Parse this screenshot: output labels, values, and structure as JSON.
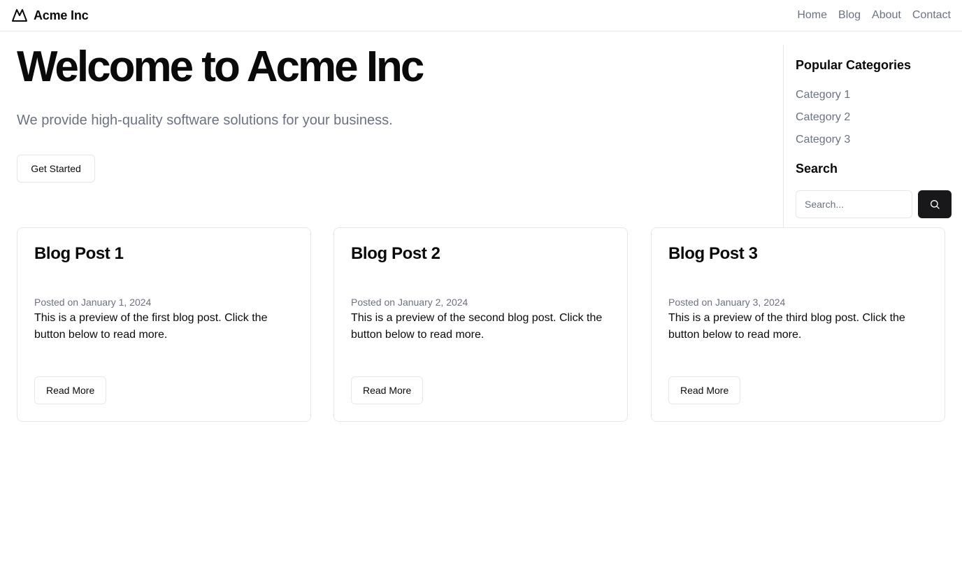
{
  "header": {
    "brand": "Acme Inc",
    "brand_icon": "mountain-icon",
    "nav": [
      {
        "label": "Home"
      },
      {
        "label": "Blog"
      },
      {
        "label": "About"
      },
      {
        "label": "Contact"
      }
    ]
  },
  "hero": {
    "title": "Welcome to Acme Inc",
    "subtitle": "We provide high-quality software solutions for your business.",
    "cta_label": "Get Started"
  },
  "sidebar": {
    "categories_heading": "Popular Categories",
    "categories": [
      {
        "label": "Category 1"
      },
      {
        "label": "Category 2"
      },
      {
        "label": "Category 3"
      }
    ],
    "search_heading": "Search",
    "search_placeholder": "Search...",
    "search_icon": "search-icon"
  },
  "posts": [
    {
      "title": "Blog Post 1",
      "date": "Posted on January 1, 2024",
      "preview": "This is a preview of the first blog post. Click the button below to read more.",
      "button_label": "Read More"
    },
    {
      "title": "Blog Post 2",
      "date": "Posted on January 2, 2024",
      "preview": "This is a preview of the second blog post. Click the button below to read more.",
      "button_label": "Read More"
    },
    {
      "title": "Blog Post 3",
      "date": "Posted on January 3, 2024",
      "preview": "This is a preview of the third blog post. Click the button below to read more.",
      "button_label": "Read More"
    }
  ],
  "colors": {
    "text": "#0a0a0a",
    "muted": "#6b7280",
    "border": "#e5e7eb",
    "primary_button": "#18181b"
  }
}
